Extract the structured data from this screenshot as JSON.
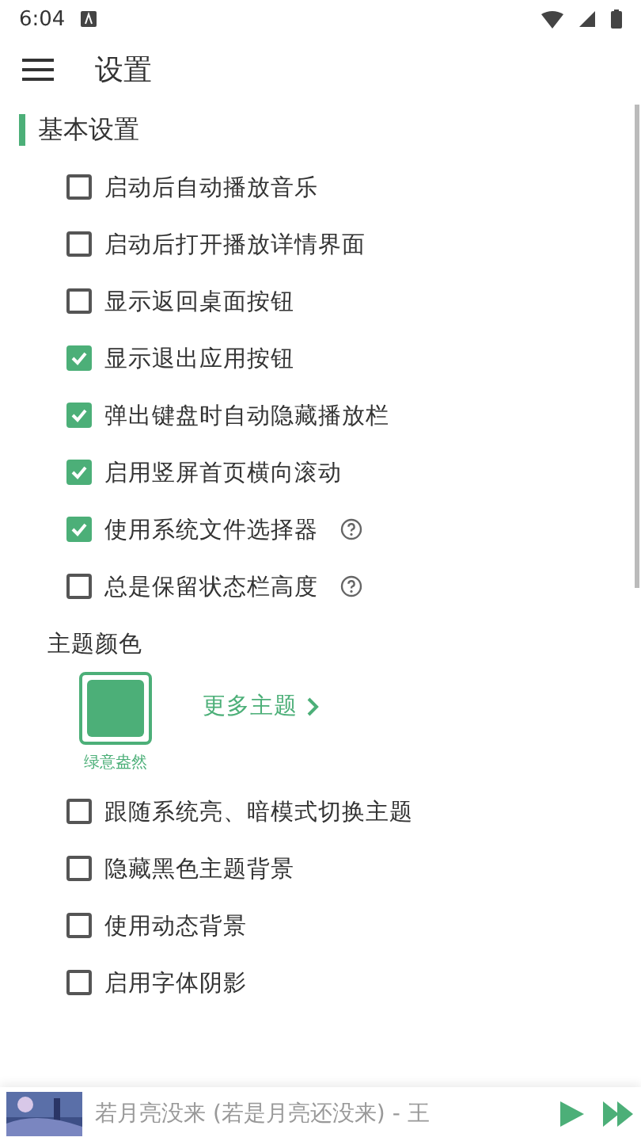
{
  "status_bar": {
    "time": "6:04"
  },
  "toolbar": {
    "title": "设置"
  },
  "section": {
    "title": "基本设置"
  },
  "options": [
    {
      "label": "启动后自动播放音乐",
      "checked": false,
      "help": false
    },
    {
      "label": "启动后打开播放详情界面",
      "checked": false,
      "help": false
    },
    {
      "label": "显示返回桌面按钮",
      "checked": false,
      "help": false
    },
    {
      "label": "显示退出应用按钮",
      "checked": true,
      "help": false
    },
    {
      "label": "弹出键盘时自动隐藏播放栏",
      "checked": true,
      "help": false
    },
    {
      "label": "启用竖屏首页横向滚动",
      "checked": true,
      "help": false
    },
    {
      "label": "使用系统文件选择器",
      "checked": true,
      "help": true
    },
    {
      "label": "总是保留状态栏高度",
      "checked": false,
      "help": true
    }
  ],
  "theme": {
    "title": "主题颜色",
    "current": {
      "name": "绿意盎然",
      "color": "#4caf78",
      "selected": true
    },
    "more": "更多主题"
  },
  "more_options": [
    {
      "label": "跟随系统亮、暗模式切换主题",
      "checked": false
    },
    {
      "label": "隐藏黑色主题背景",
      "checked": false
    },
    {
      "label": "使用动态背景",
      "checked": false
    },
    {
      "label": "启用字体阴影",
      "checked": false
    }
  ],
  "player": {
    "song": "若月亮没来 (若是月亮还没来) - 王"
  }
}
